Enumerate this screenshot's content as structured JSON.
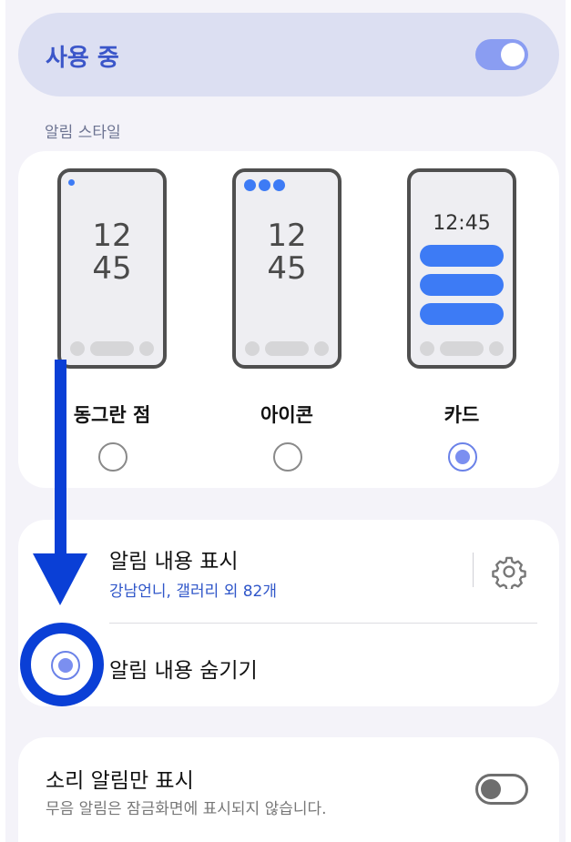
{
  "master": {
    "label": "사용 중",
    "enabled": true
  },
  "section_title": "알림 스타일",
  "styles": [
    {
      "label": "동그란 점",
      "clock": [
        "12",
        "45"
      ],
      "selected": false
    },
    {
      "label": "아이콘",
      "clock": [
        "12",
        "45"
      ],
      "selected": false
    },
    {
      "label": "카드",
      "clock_small": "12:45",
      "selected": true
    }
  ],
  "content": {
    "show": {
      "title": "알림 내용 표시",
      "subtitle": "강남언니, 갤러리 외 82개"
    },
    "hide": {
      "title": "알림 내용 숨기기",
      "selected": true
    }
  },
  "sound_only": {
    "title": "소리 알림만 표시",
    "subtitle": "무음 알림은 잠금화면에 표시되지 않습니다.",
    "enabled": false
  },
  "colors": {
    "accent": "#3b56c9",
    "toggle_on": "#8a9df2",
    "annotation": "#0a3fd6",
    "notif_blue": "#3d7bf5"
  }
}
